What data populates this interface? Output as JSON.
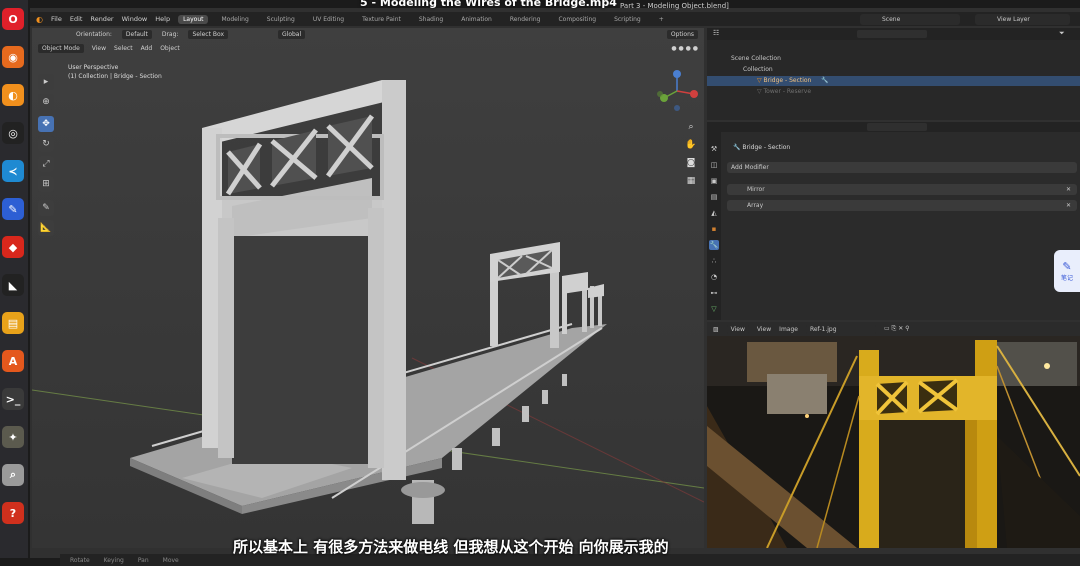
{
  "video": {
    "title": "5 - Modeling the Wires of the Bridge.mp4"
  },
  "dock": {
    "apps": [
      {
        "name": "opera-icon",
        "glyph": "O",
        "color": "#e0202a"
      },
      {
        "name": "firefox-icon",
        "glyph": "◉",
        "color": "#e66a1e"
      },
      {
        "name": "blender-icon",
        "glyph": "◐",
        "color": "#f1901d"
      },
      {
        "name": "obs-icon",
        "glyph": "◎",
        "color": "#222222"
      },
      {
        "name": "vscode-icon",
        "glyph": "≺",
        "color": "#1f8ad2"
      },
      {
        "name": "text-editor-icon",
        "glyph": "✎",
        "color": "#2d5fd4"
      },
      {
        "name": "anydesk-icon",
        "glyph": "◆",
        "color": "#d8271c"
      },
      {
        "name": "inkscape-icon",
        "glyph": "◣",
        "color": "#222222"
      },
      {
        "name": "notes-icon",
        "glyph": "▤",
        "color": "#e8a21a"
      },
      {
        "name": "app-store-icon",
        "glyph": "A",
        "color": "#e4581d"
      },
      {
        "name": "terminal-icon",
        "glyph": ">_",
        "color": "#3a3a3a"
      },
      {
        "name": "gimp-icon",
        "glyph": "✦",
        "color": "#5b5a4e"
      },
      {
        "name": "magnifier-icon",
        "glyph": "⌕",
        "color": "#9a9a9a"
      },
      {
        "name": "help-icon",
        "glyph": "?",
        "color": "#d0301d"
      }
    ]
  },
  "blender": {
    "file_title": "Part 3 - Modeling Object.blend]",
    "menus": [
      "File",
      "Edit",
      "Render",
      "Window",
      "Help"
    ],
    "workspaces": [
      "Layout",
      "Modeling",
      "Sculpting",
      "UV Editing",
      "Texture Paint",
      "Shading",
      "Animation",
      "Rendering",
      "Compositing",
      "Scripting"
    ],
    "active_workspace": "Layout",
    "scene": "Scene",
    "view_layer": "View Layer"
  },
  "viewport": {
    "header": {
      "orientation_label": "Orientation:",
      "orientation": "Default",
      "drag_label": "Drag:",
      "drag": "Select Box",
      "transform": "Global",
      "options": "Options"
    },
    "header2": {
      "mode": "Object Mode",
      "menus": [
        "View",
        "Select",
        "Add",
        "Object"
      ]
    },
    "info_line1": "User Perspective",
    "info_line2": "(1) Collection | Bridge - Section"
  },
  "outliner": {
    "rows": [
      {
        "label": "Scene Collection"
      },
      {
        "label": "Collection"
      },
      {
        "label": "Bridge - Section"
      },
      {
        "label": "Tower - Reserve"
      }
    ]
  },
  "properties": {
    "object_name": "Bridge - Section",
    "add_modifier": "Add Modifier",
    "modifiers": [
      {
        "name": "Mirror"
      },
      {
        "name": "Array"
      }
    ]
  },
  "image_editor": {
    "menus": [
      "View",
      "View",
      "Image"
    ],
    "image_name": "Ref-1.jpg"
  },
  "notes_button": {
    "label": "笔记"
  },
  "statusbar": {
    "items": [
      "Rotate",
      "Keying",
      "Pan",
      "Move"
    ]
  },
  "subtitle": "所以基本上 有很多方法来做电线 但我想从这个开始 向你展示我的",
  "colors": {
    "active_tool": "#4772b3",
    "selection_orange": "#f1901d",
    "header_bg": "#232323"
  }
}
